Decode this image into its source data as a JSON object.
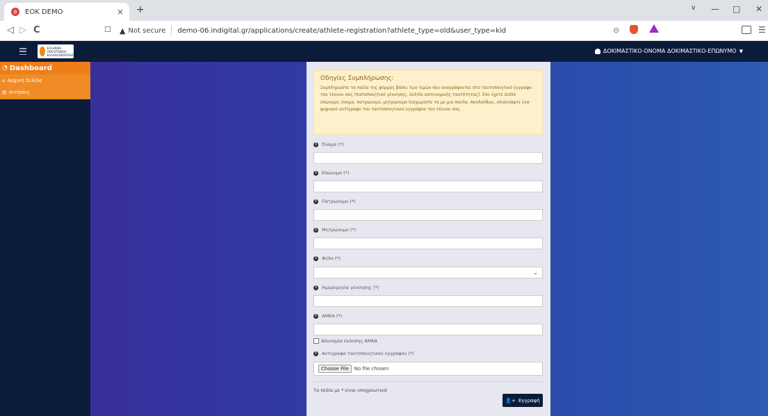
{
  "browser": {
    "tab_title": "EOK DEMO",
    "tab_close": "×",
    "new_tab": "+",
    "not_secure": "Not secure",
    "url": "demo-06.indigital.gr/applications/create/athlete-registration?athlete_type=old&user_type=kid",
    "back": "◁",
    "forward": "▷",
    "reload": "C",
    "bookmark": "☐",
    "minimize": "—",
    "maximize": "□",
    "close": "✕",
    "dropdown": "∨"
  },
  "header": {
    "user_name": "ΔΟΚΙΜΑΣΤΙΚΟ-ΟΝΟΜΑ ΔΟΚΙΜΑΣΤΙΚΟ-ΕΠΩΝΥΜΟ"
  },
  "sidebar": {
    "dashboard": "Dashboard",
    "items": [
      {
        "label": "Αρχική Σελίδα",
        "icon": "home-icon"
      },
      {
        "label": "Αιτήσεις",
        "icon": "list-icon"
      }
    ]
  },
  "form": {
    "alert_title": "Οδηγίες Συμπλήρωσης:",
    "alert_body": "Συμπληρώστε τα πεδία της φόρμας βάσει των τιμών που αναγράφονται στο ταυτοποιητικό έγγραφο του τέκνου σας (πιστοποιητικό γέννησης, δελτίο αστυνομικής ταυτότητας). Εάν έχετε διπλό επώνυμο, όνομα, πατρώνυμο, μητρώνυμο διαχωρίστε τα με μια παύλα. Ακολούθως, επισυνάψτε ένα ψηφιακό αντίγραφο του ταυτοποιητικού εγγράφου του τέκνου σας.",
    "fields": [
      {
        "label": "Όνομα (*)",
        "value": ""
      },
      {
        "label": "Επώνυμο (*)",
        "value": ""
      },
      {
        "label": "Πατρώνυμο (*)",
        "value": ""
      },
      {
        "label": "Μητρώνυμο (*)",
        "value": ""
      },
      {
        "label": "Φύλο (*)",
        "value": ""
      },
      {
        "label": "Ημερομηνία γέννησης (*)",
        "value": ""
      },
      {
        "label": "ΑΜΚΑ (*)",
        "value": ""
      }
    ],
    "checkbox_label": "Αδυναμία έκδοσης ΑΜΚΑ",
    "file_label": "Αντίγραφο ταυτοποιητικού εγγράφου (*)",
    "file_button": "Choose File",
    "file_status": "No file chosen",
    "required_note": "Τα πεδία με * είναι υποχρεωτικά",
    "submit": "Εγγραφή"
  },
  "colors": {
    "header": "#0b1b3a",
    "accent": "#ee7d1a",
    "alert_bg": "#fdf1cd"
  }
}
